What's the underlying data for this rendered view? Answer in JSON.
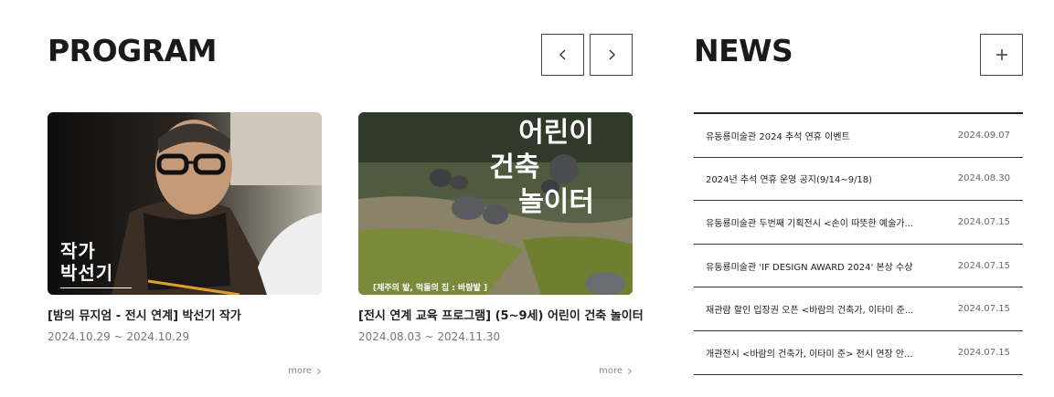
{
  "program": {
    "title": "PROGRAM",
    "prev_icon": "chevron-left-icon",
    "next_icon": "chevron-right-icon",
    "cards": [
      {
        "image_overlay_lines": [
          "작가",
          "박선기"
        ],
        "title": "[밤의 뮤지엄 - 전시 연계] 박선기 작가",
        "date": "2024.10.29 ~ 2024.10.29",
        "more": "more"
      },
      {
        "image_overlay_lines": [
          "어린이",
          "건축",
          "놀이터"
        ],
        "image_caption": "[제주의 밭, 먹돌의 집 : 바람밭 ]",
        "title": "[전시 연계 교육 프로그램] (5~9세) 어린이 건축 놀이터",
        "date": "2024.08.03 ~ 2024.11.30",
        "more": "more"
      }
    ]
  },
  "news": {
    "title": "NEWS",
    "plus_icon": "plus-icon",
    "items": [
      {
        "text": "유동룡미술관 2024 추석 연휴 이벤트",
        "date": "2024.09.07"
      },
      {
        "text": "2024년 추석 연휴 운영 공지(9/14~9/18)",
        "date": "2024.08.30"
      },
      {
        "text": "유동룡미술관 두번째 기획전시 <손이 따뜻한 예술가...",
        "date": "2024.07.15"
      },
      {
        "text": "유동룡미술관 'IF DESIGN AWARD 2024' 본상 수상",
        "date": "2024.07.15"
      },
      {
        "text": "재관람 할인 입장권 오픈 <바람의 건축가, 이타미 준...",
        "date": "2024.07.15"
      },
      {
        "text": "개관전시 <바람의 건축가, 이타미 준> 전시 연장 안...",
        "date": "2024.07.15"
      }
    ]
  }
}
